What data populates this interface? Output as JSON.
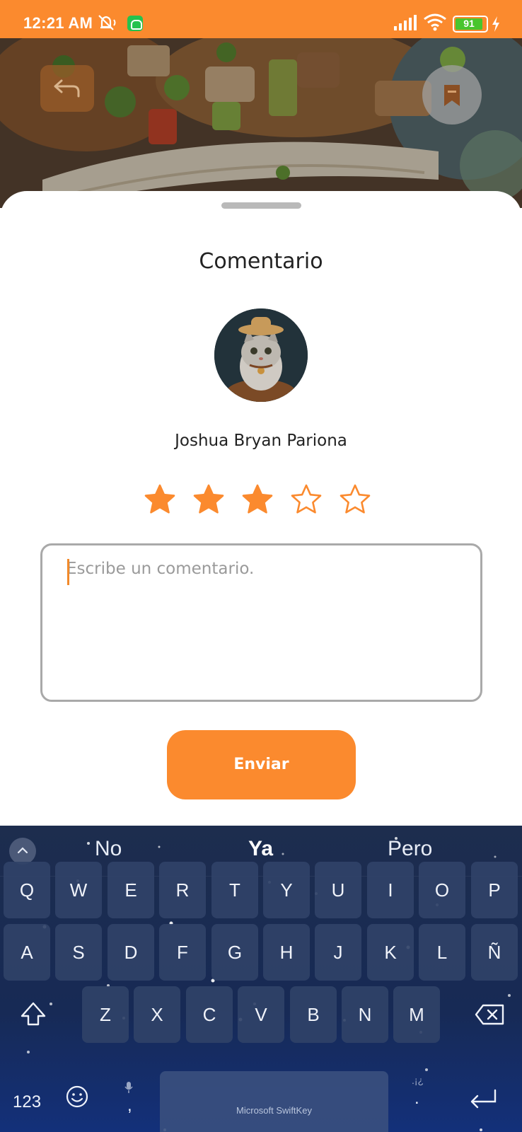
{
  "status_bar": {
    "time": "12:21 AM",
    "battery_level": "91",
    "battery_percent": 91,
    "icons": [
      "mute-icon",
      "app-notification-icon",
      "signal-icon",
      "wifi-icon",
      "battery-icon",
      "charging-bolt-icon"
    ],
    "background_color": "#fb8a2e"
  },
  "hero": {
    "back_icon": "back-arrow-icon",
    "bookmark_icon": "bookmark-icon"
  },
  "sheet": {
    "title": "Comentario",
    "user_name": "Joshua Bryan Pariona",
    "rating": 3,
    "rating_max": 5,
    "comment_placeholder": "Escribe un comentario.",
    "comment_value": "",
    "send_label": "Enviar",
    "accent_color": "#fb8a2e"
  },
  "keyboard": {
    "suggestions": [
      "No",
      "Ya",
      "Pero"
    ],
    "rows": [
      [
        "Q",
        "W",
        "E",
        "R",
        "T",
        "Y",
        "U",
        "I",
        "O",
        "P"
      ],
      [
        "A",
        "S",
        "D",
        "F",
        "G",
        "H",
        "J",
        "K",
        "L",
        "Ñ"
      ],
      [
        "Z",
        "X",
        "C",
        "V",
        "B",
        "N",
        "M"
      ]
    ],
    "numbers_label": "123",
    "comma_label": ",",
    "period_label": ".",
    "punct_hint": ".¡¿",
    "space_label": "Microsoft SwiftKey"
  }
}
